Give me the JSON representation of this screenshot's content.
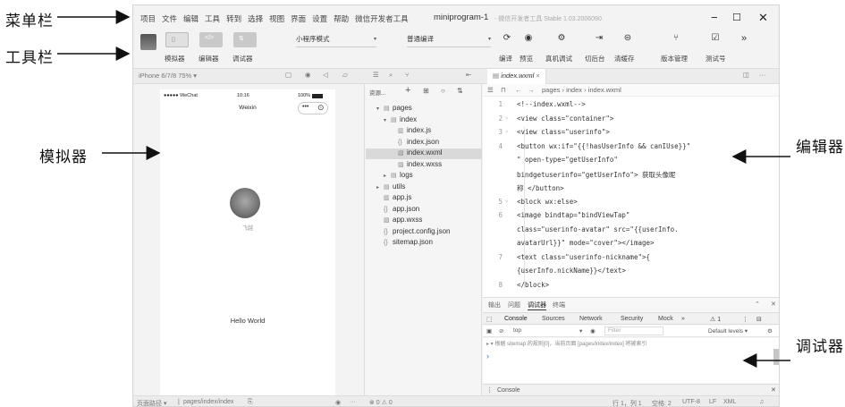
{
  "annotations": {
    "menubar": "菜单栏",
    "toolbar": "工具栏",
    "simulator": "模拟器",
    "editor": "编辑器",
    "debugger": "调试器"
  },
  "menubar": {
    "items": [
      "项目",
      "文件",
      "编辑",
      "工具",
      "转到",
      "选择",
      "视图",
      "界面",
      "设置",
      "帮助",
      "微信开发者工具"
    ],
    "title": "miniprogram-1",
    "subtitle": "- 微信开发者工具 Stable 1.03.2006090",
    "min": "−",
    "max": "☐",
    "close": "✕"
  },
  "toolbar": {
    "toggles": [
      "模拟器",
      "编辑器",
      "调试器"
    ],
    "mode_select": "小程序模式",
    "compile_select": "普通编译",
    "actions": [
      "编译",
      "预览",
      "真机调试",
      "切后台",
      "清缓存",
      "版本管理",
      "测试号"
    ],
    "more": "»"
  },
  "subbar": {
    "device": "iPhone 6/7/8 75% ▾",
    "file_tab": "index.wxml",
    "file_tab_close": "×",
    "more": "···"
  },
  "simulator": {
    "carrier": "●●●●● WeChat",
    "time": "10:16",
    "battery": "100%",
    "nav_title": "Weixin",
    "nickname": "飞越",
    "hello": "Hello World"
  },
  "explorer": {
    "header": "资源...",
    "tree": [
      {
        "label": "pages",
        "indent": 1,
        "twisty": "▾",
        "icon": "folder-icon",
        "glyph": "▤"
      },
      {
        "label": "index",
        "indent": 2,
        "twisty": "▾",
        "icon": "folder-icon",
        "glyph": "▤"
      },
      {
        "label": "index.js",
        "indent": 3,
        "twisty": "",
        "icon": "js-icon",
        "glyph": "▥"
      },
      {
        "label": "index.json",
        "indent": 3,
        "twisty": "",
        "icon": "json-icon",
        "glyph": "{}"
      },
      {
        "label": "index.wxml",
        "indent": 3,
        "twisty": "",
        "icon": "wxml-icon",
        "glyph": "▧",
        "selected": true
      },
      {
        "label": "index.wxss",
        "indent": 3,
        "twisty": "",
        "icon": "wxss-icon",
        "glyph": "▨"
      },
      {
        "label": "logs",
        "indent": 2,
        "twisty": "▸",
        "icon": "folder-icon",
        "glyph": "▤"
      },
      {
        "label": "utils",
        "indent": 1,
        "twisty": "▸",
        "icon": "folder-icon",
        "glyph": "▤"
      },
      {
        "label": "app.js",
        "indent": 1,
        "twisty": "",
        "icon": "js-icon",
        "glyph": "▥"
      },
      {
        "label": "app.json",
        "indent": 1,
        "twisty": "",
        "icon": "json-icon",
        "glyph": "{}"
      },
      {
        "label": "app.wxss",
        "indent": 1,
        "twisty": "",
        "icon": "wxss-icon",
        "glyph": "▨"
      },
      {
        "label": "project.config.json",
        "indent": 1,
        "twisty": "",
        "icon": "json-icon",
        "glyph": "{}"
      },
      {
        "label": "sitemap.json",
        "indent": 1,
        "twisty": "",
        "icon": "json-icon",
        "glyph": "{}"
      }
    ]
  },
  "editor": {
    "breadcrumb": "pages › index › index.wxml",
    "lines": [
      {
        "n": "1",
        "fold": "",
        "text": "<!--index.wxml-->"
      },
      {
        "n": "2",
        "fold": "˅",
        "text": "<view class=\"container\">"
      },
      {
        "n": "3",
        "fold": "˅",
        "text": "  <view class=\"userinfo\">"
      },
      {
        "n": "4",
        "fold": "",
        "text": "    <button wx:if=\"{{!hasUserInfo && canIUse}}\""
      },
      {
        "n": "",
        "fold": "",
        "text": "    \" open-type=\"getUserInfo\""
      },
      {
        "n": "",
        "fold": "",
        "text": "    bindgetuserinfo=\"getUserInfo\"> 获取头像昵"
      },
      {
        "n": "",
        "fold": "",
        "text": "    称 </button>"
      },
      {
        "n": "5",
        "fold": "˅",
        "text": "    <block wx:else>"
      },
      {
        "n": "6",
        "fold": "",
        "text": "      <image bindtap=\"bindViewTap\""
      },
      {
        "n": "",
        "fold": "",
        "text": "      class=\"userinfo-avatar\" src=\"{{userInfo."
      },
      {
        "n": "",
        "fold": "",
        "text": "      avatarUrl}}\" mode=\"cover\"></image>"
      },
      {
        "n": "7",
        "fold": "",
        "text": "      <text class=\"userinfo-nickname\">{"
      },
      {
        "n": "",
        "fold": "",
        "text": "      {userInfo.nickName}}</text>"
      },
      {
        "n": "8",
        "fold": "",
        "text": "    </block>"
      }
    ]
  },
  "debugger": {
    "panel_tabs": [
      "输出",
      "问题",
      "调试器",
      "终端"
    ],
    "dev_tabs": [
      "Console",
      "Sources",
      "Network",
      "Security",
      "Mock",
      "»"
    ],
    "warn_count": "⚠ 1",
    "context": "top",
    "filter_placeholder": "Filter",
    "levels": "Default levels ▾",
    "console_text": "▸ ▾ 根据 sitemap 的规则[0]，当前页面 [pages/index/index] 将被索引",
    "prompt": "›",
    "bottom_tab": "Console"
  },
  "statusbar": {
    "path_label": "页面路径 ▾",
    "path": "pages/index/index",
    "problems": "⊗ 0 ⚠ 0",
    "cursor": "行 1，列 1",
    "spaces": "空格: 2",
    "encoding": "UTF-8",
    "eol": "LF",
    "lang": "XML"
  }
}
